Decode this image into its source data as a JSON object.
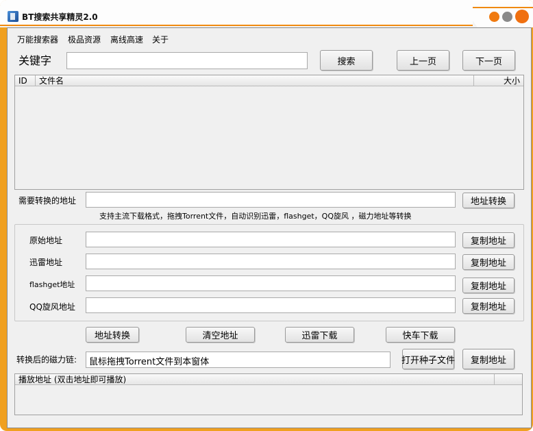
{
  "window": {
    "title": "BT搜索共享精灵2.0"
  },
  "menu": {
    "items": [
      "万能搜索器",
      "极品资源",
      "离线高速",
      "关于"
    ]
  },
  "search": {
    "keyword_label": "关键字",
    "keyword_value": "",
    "search_button": "搜索",
    "prev_button": "上一页",
    "next_button": "下一页"
  },
  "results": {
    "columns": [
      "ID",
      "文件名",
      "大小"
    ],
    "rows": []
  },
  "convert": {
    "input_label": "需要转换的地址",
    "input_value": "",
    "convert_button": "地址转换",
    "hint": "支持主流下载格式，拖拽Torrent文件，自动识别迅雷，flashget，QQ旋风 ，磁力地址等转换"
  },
  "addresses": [
    {
      "label": "原始地址",
      "value": "",
      "button": "复制地址"
    },
    {
      "label": "迅雷地址",
      "value": "",
      "button": "复制地址"
    },
    {
      "label": "flashget地址",
      "value": "",
      "button": "复制地址"
    },
    {
      "label": "QQ旋风地址",
      "value": "",
      "button": "复制地址"
    }
  ],
  "actions": {
    "convert": "地址转换",
    "clear": "清空地址",
    "thunder_download": "迅雷下载",
    "kuaiche_download": "快车下载"
  },
  "magnet": {
    "label": "转换后的磁力链:",
    "value": "鼠标拖拽Torrent文件到本窗体",
    "open_seed_button": "打开种子文件",
    "copy_button": "复制地址"
  },
  "playlist": {
    "columns": [
      "播放地址 (双击地址即可播放)",
      ""
    ]
  },
  "colors": {
    "accent": "#f08a10",
    "client_bg": "#f0f0f0"
  }
}
